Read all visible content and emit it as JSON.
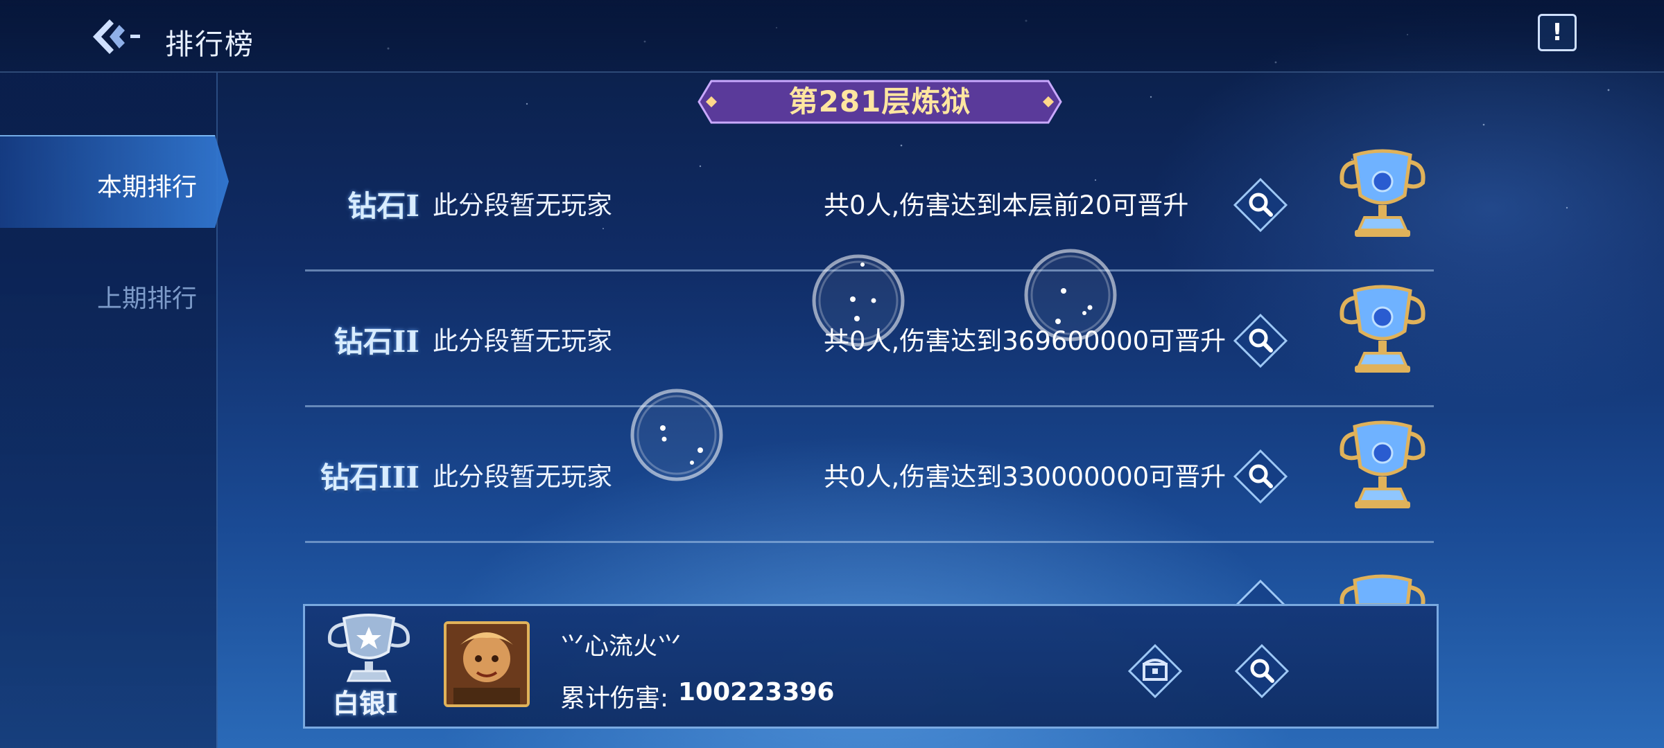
{
  "header": {
    "title": "排行榜",
    "notice_symbol": "!"
  },
  "sidebar": {
    "tabs": [
      {
        "label": "本期排行",
        "active": true
      },
      {
        "label": "上期排行",
        "active": false
      }
    ]
  },
  "banner": {
    "title": "第281层炼狱"
  },
  "rows": [
    {
      "rank": "钻石I",
      "status": "此分段暂无玩家",
      "requirement": "共0人,伤害达到本层前20可晋升"
    },
    {
      "rank": "钻石II",
      "status": "此分段暂无玩家",
      "requirement": "共0人,伤害达到369600000可晋升"
    },
    {
      "rank": "钻石III",
      "status": "此分段暂无玩家",
      "requirement": "共0人,伤害达到330000000可晋升"
    }
  ],
  "player": {
    "rank": "白银I",
    "name": "⺍心流火⺍",
    "damage_label": "累计伤害:",
    "damage_value": "100223396"
  },
  "colors": {
    "banner": "#5a3a9a",
    "banner_text": "#ffe6a0",
    "accent": "#8cc8ff",
    "trophy_gold": "#d9a54a"
  }
}
